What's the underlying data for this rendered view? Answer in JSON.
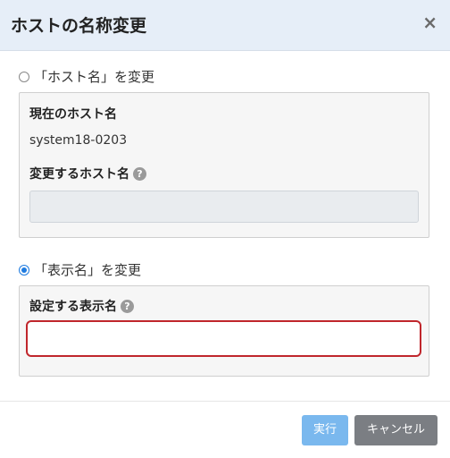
{
  "dialog": {
    "title": "ホストの名称変更",
    "close_label": "×"
  },
  "option_host": {
    "label": "「ホスト名」を変更",
    "selected": false,
    "current_label": "現在のホスト名",
    "current_value": "system18-0203",
    "new_label": "変更するホスト名",
    "help_icon": "question-circle-icon",
    "new_value": ""
  },
  "option_display": {
    "label": "「表示名」を変更",
    "selected": true,
    "field_label": "設定する表示名",
    "help_icon": "question-circle-icon",
    "field_value": ""
  },
  "buttons": {
    "run": "実行",
    "cancel": "キャンセル"
  },
  "colors": {
    "header_bg": "#e6eef8",
    "radio_selected": "#1e7be0",
    "input_focus_border": "#c0262c",
    "run_button": "#7ab8ee",
    "cancel_button": "#7b7e83"
  }
}
